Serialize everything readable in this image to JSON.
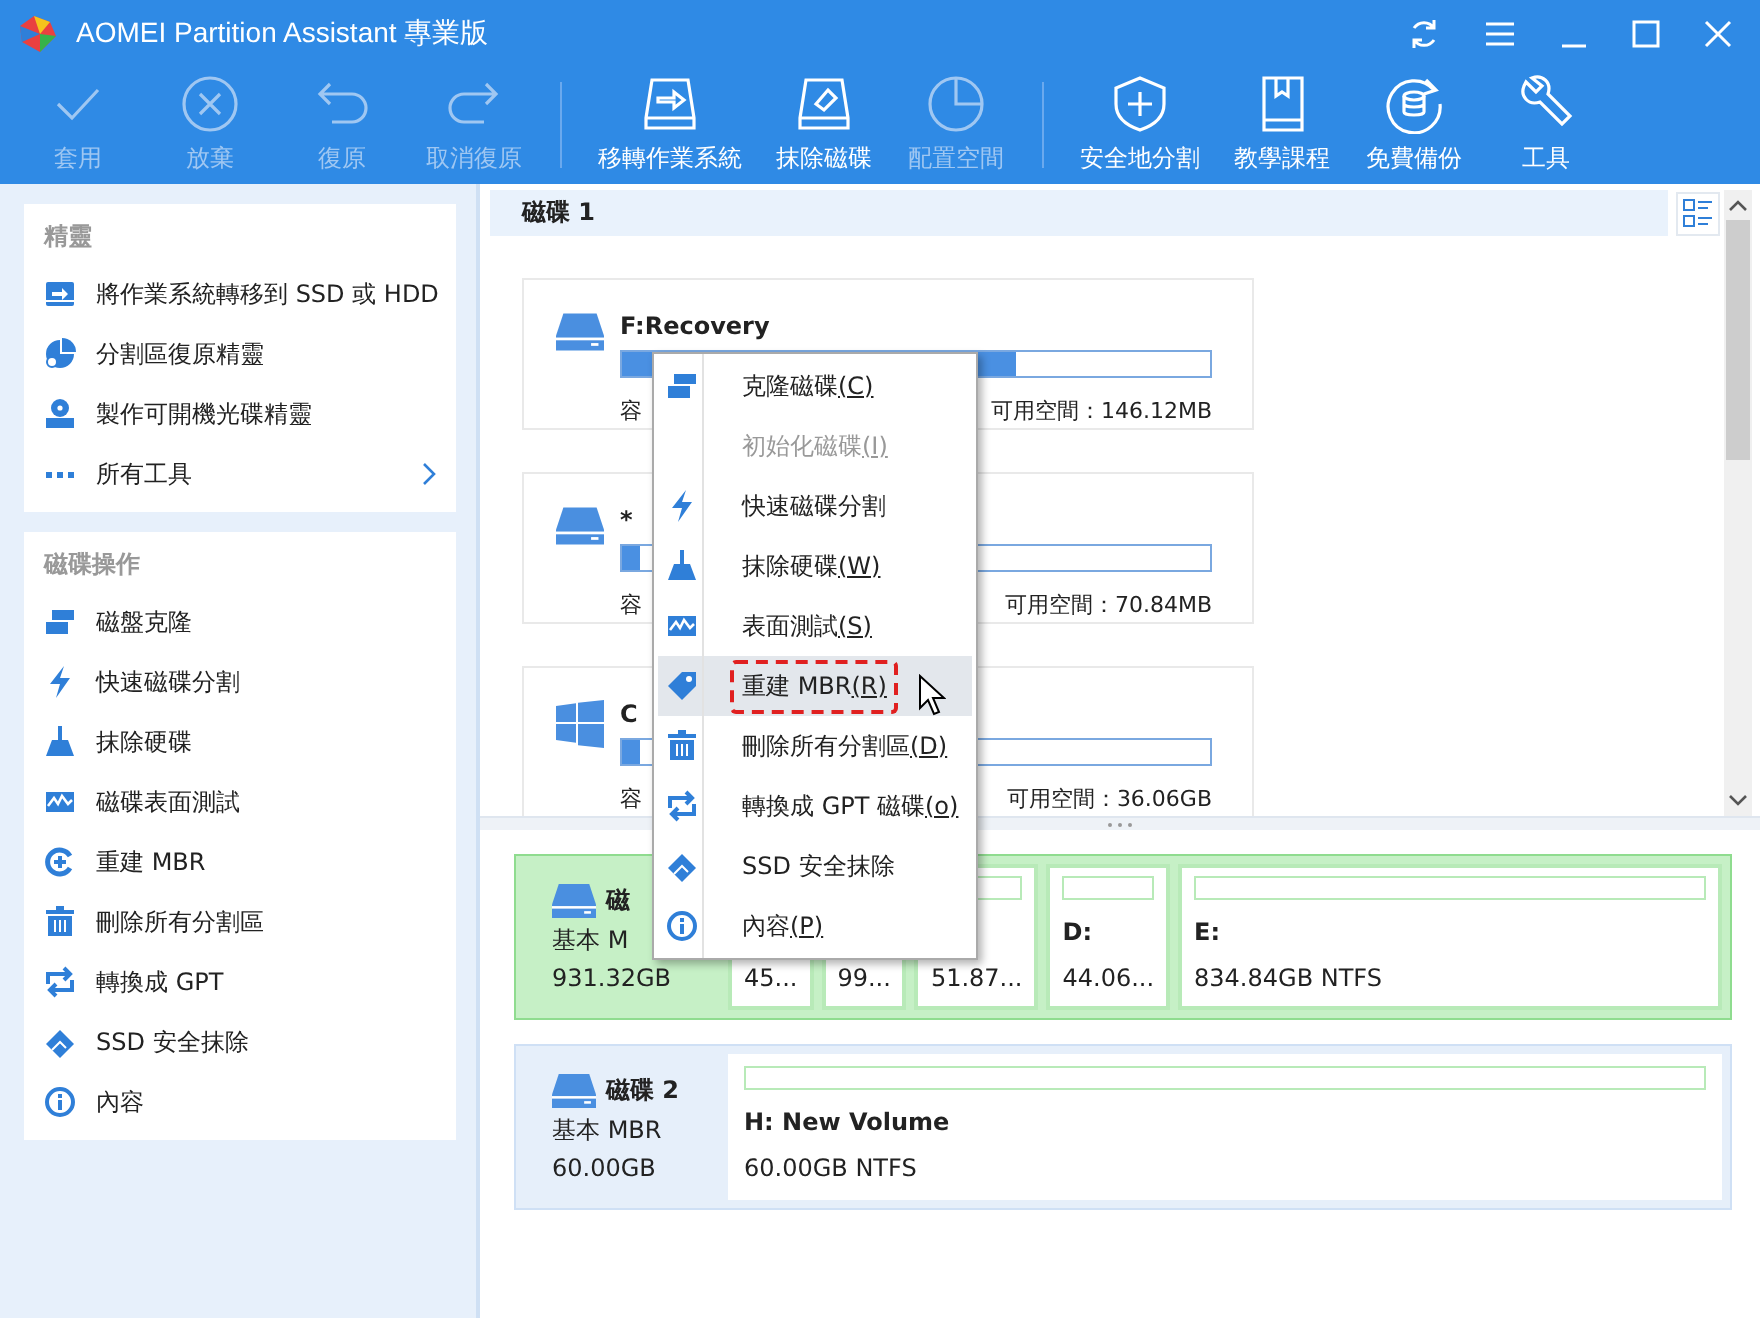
{
  "window": {
    "title": "AOMEI Partition Assistant 專業版"
  },
  "toolbar": [
    {
      "label": "套用",
      "disabled": true
    },
    {
      "label": "放棄",
      "disabled": true
    },
    {
      "label": "復原",
      "disabled": true
    },
    {
      "label": "取消復原",
      "disabled": true,
      "separator_after": true
    },
    {
      "label": "移轉作業系統",
      "disabled": false
    },
    {
      "label": "抹除磁碟",
      "disabled": false
    },
    {
      "label": "配置空間",
      "disabled": true,
      "separator_after": true
    },
    {
      "label": "安全地分割",
      "disabled": false
    },
    {
      "label": "教學課程",
      "disabled": false
    },
    {
      "label": "免費備份",
      "disabled": false
    },
    {
      "label": "工具",
      "disabled": false
    }
  ],
  "sidebar": {
    "sections": [
      {
        "title": "精靈",
        "items": [
          {
            "label": "將作業系統轉移到 SSD 或 HDD",
            "expandable": false
          },
          {
            "label": "分割區復原精靈",
            "expandable": false
          },
          {
            "label": "製作可開機光碟精靈",
            "expandable": false
          },
          {
            "label": "所有工具",
            "expandable": true
          }
        ]
      },
      {
        "title": "磁碟操作",
        "items": [
          {
            "label": "磁盤克隆",
            "expandable": false
          },
          {
            "label": "快速磁碟分割",
            "expandable": false
          },
          {
            "label": "抹除硬碟",
            "expandable": false
          },
          {
            "label": "磁碟表面測試",
            "expandable": false
          },
          {
            "label": "重建 MBR",
            "expandable": false
          },
          {
            "label": "刪除所有分割區",
            "expandable": false
          },
          {
            "label": "轉換成 GPT",
            "expandable": false
          },
          {
            "label": "SSD 安全抹除",
            "expandable": false
          },
          {
            "label": "內容",
            "expandable": false
          }
        ]
      }
    ]
  },
  "disk_panel": {
    "header": "磁碟 1",
    "partitions": [
      {
        "kind": "drive",
        "name": "F:Recovery",
        "level": 0.67,
        "capacity": "容",
        "free": "可用空間：146.12MB"
      },
      {
        "kind": "drive",
        "name": "*",
        "level": 0.03,
        "capacity": "容",
        "free": "可用空間：70.84MB"
      },
      {
        "kind": "system",
        "name": "C",
        "level": 0.03,
        "capacity": "容",
        "free": "可用空間：36.06GB"
      }
    ]
  },
  "disk_map": [
    {
      "name": "磁",
      "type": "基本 M",
      "size": "931.32GB",
      "selected": true,
      "partitions": [
        {
          "size": "45...",
          "bar": false
        },
        {
          "size": "99...",
          "bar": false
        },
        {
          "size": "51.87...",
          "bar": true
        },
        {
          "label": "D:",
          "size": "44.06...",
          "bar": true
        },
        {
          "label": "E:",
          "size": "834.84GB NTFS",
          "bar": true
        }
      ]
    },
    {
      "name": "磁碟 2",
      "type": "基本 MBR",
      "size": "60.00GB",
      "selected": false,
      "partitions": [
        {
          "label": "H: New Volume",
          "size": "60.00GB NTFS",
          "bar": true
        }
      ]
    }
  ],
  "context_menu": {
    "items": [
      {
        "label": "克隆磁碟",
        "shortcut": "(C)",
        "disabled": false,
        "selected": false,
        "annotated": false
      },
      {
        "label": "初始化磁碟",
        "shortcut": "(I)",
        "disabled": true,
        "selected": false,
        "annotated": false
      },
      {
        "label": "快速磁碟分割",
        "disabled": false,
        "selected": false,
        "annotated": false
      },
      {
        "label": "抹除硬碟",
        "shortcut": "(W)",
        "disabled": false,
        "selected": false,
        "annotated": false
      },
      {
        "label": "表面測試",
        "shortcut": "(S)",
        "disabled": false,
        "selected": false,
        "annotated": false
      },
      {
        "label": "重建 MBR",
        "shortcut": "(R)",
        "disabled": false,
        "selected": true,
        "annotated": true
      },
      {
        "label": "刪除所有分割區",
        "shortcut": "(D)",
        "disabled": false,
        "selected": false,
        "annotated": false
      },
      {
        "label": "轉換成 GPT 磁碟",
        "shortcut": "(o)",
        "disabled": false,
        "selected": false,
        "annotated": false
      },
      {
        "label": "SSD 安全抹除",
        "disabled": false,
        "selected": false,
        "annotated": false
      },
      {
        "label": "內容",
        "shortcut": "(P)",
        "disabled": false,
        "selected": false,
        "annotated": false
      }
    ]
  }
}
